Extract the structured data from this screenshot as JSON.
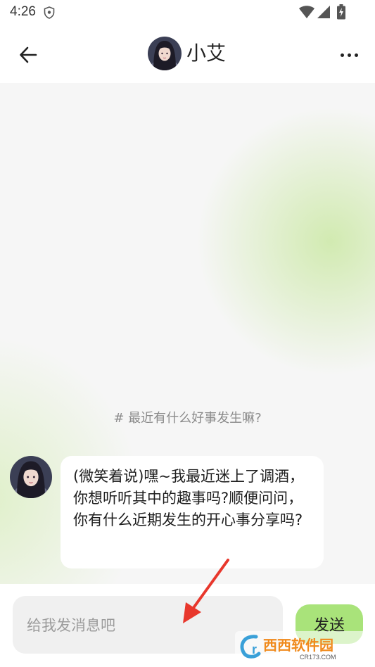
{
  "status_bar": {
    "time": "4:26",
    "icons": [
      "shield-icon",
      "wifi-icon",
      "signal-icon",
      "battery-icon"
    ]
  },
  "header": {
    "back_icon": "arrow-left-icon",
    "title": "小艾",
    "more_icon": "more-horizontal-icon"
  },
  "chat": {
    "topic": "# 最近有什么好事发生嘛?",
    "messages": [
      {
        "sender": "小艾",
        "text": "(微笑着说)嘿~我最近迷上了调酒，你想听听其中的趣事吗?顺便问问，你有什么近期发生的开心事分享吗?"
      }
    ]
  },
  "composer": {
    "placeholder": "给我发消息吧",
    "send_label": "发送"
  },
  "watermark": {
    "text": "西西软件园",
    "url_text": "CR173.COM"
  },
  "colors": {
    "accent": "#a9e37a",
    "background": "#f6f6f6",
    "annotation_arrow": "#e8372c"
  }
}
